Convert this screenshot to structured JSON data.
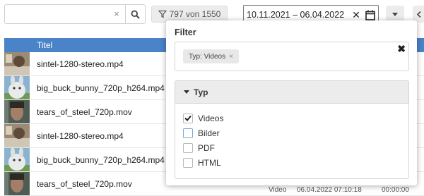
{
  "toolbar": {
    "search": {
      "value": "",
      "placeholder": "",
      "clear_glyph": "×"
    },
    "count_label": "797 von 1550",
    "date_range": "10.11.2021 – 06.04.2022",
    "date_clear_glyph": "✕"
  },
  "table": {
    "header": "Titel",
    "rows": [
      {
        "name": "sintel-1280-stereo.mp4",
        "thumb": "sintel"
      },
      {
        "name": "big_buck_bunny_720p_h264.mp4",
        "thumb": "bunny"
      },
      {
        "name": "tears_of_steel_720p.mov",
        "thumb": "steel"
      },
      {
        "name": "sintel-1280-stereo.mp4",
        "thumb": "sintel"
      },
      {
        "name": "big_buck_bunny_720p_h264.mp4",
        "thumb": "bunny"
      },
      {
        "name": "tears_of_steel_720p.mov",
        "thumb": "steel"
      }
    ],
    "partial_last_row": [
      "Video",
      "06.04.2022 07:10:18",
      "00:00:00"
    ]
  },
  "filter_popup": {
    "title": "Filter",
    "active_chip": "Typ: Videos",
    "chip_remove_glyph": "×",
    "close_glyph": "✖",
    "group_title": "Typ",
    "options": [
      {
        "label": "Videos",
        "checked": true
      },
      {
        "label": "Bilder",
        "checked": false
      },
      {
        "label": "PDF",
        "checked": false
      },
      {
        "label": "HTML",
        "checked": false
      }
    ]
  },
  "colors": {
    "header_blue": "#4a83c7",
    "chip_bg": "#e8e8e8",
    "group_bg": "#ececec"
  },
  "icons": [
    "search-icon",
    "filter-icon",
    "calendar-icon",
    "chevron-down-icon",
    "chevron-left-icon",
    "caret-down-icon",
    "check-icon"
  ]
}
